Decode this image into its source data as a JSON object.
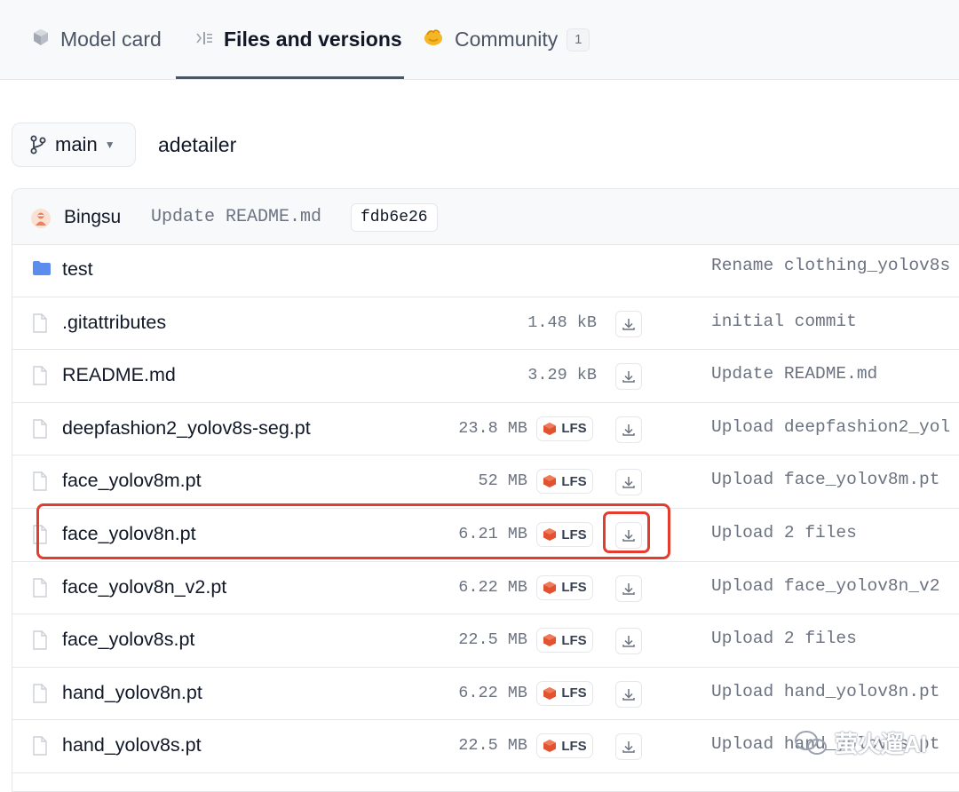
{
  "tabs": [
    {
      "label": "Model card",
      "icon": "cube-icon",
      "active": false
    },
    {
      "label": "Files and versions",
      "icon": "files-icon",
      "active": true
    },
    {
      "label": "Community",
      "icon": "hand-icon",
      "active": false,
      "count": "1"
    }
  ],
  "branch": {
    "label": "main"
  },
  "repo_name": "adetailer",
  "last_commit": {
    "author": "Bingsu",
    "message": "Update README.md",
    "sha": "fdb6e26"
  },
  "files": [
    {
      "name": "test",
      "type": "folder",
      "size": "",
      "lfs": false,
      "commit": "Rename clothing_yolov8s"
    },
    {
      "name": ".gitattributes",
      "type": "file",
      "size": "1.48 kB",
      "lfs": false,
      "commit": "initial commit"
    },
    {
      "name": "README.md",
      "type": "file",
      "size": "3.29 kB",
      "lfs": false,
      "commit": "Update README.md"
    },
    {
      "name": "deepfashion2_yolov8s-seg.pt",
      "type": "file",
      "size": "23.8 MB",
      "lfs": true,
      "commit": "Upload deepfashion2_yol"
    },
    {
      "name": "face_yolov8m.pt",
      "type": "file",
      "size": "52 MB",
      "lfs": true,
      "commit": "Upload face_yolov8m.pt"
    },
    {
      "name": "face_yolov8n.pt",
      "type": "file",
      "size": "6.21 MB",
      "lfs": true,
      "commit": "Upload 2 files",
      "highlighted": true
    },
    {
      "name": "face_yolov8n_v2.pt",
      "type": "file",
      "size": "6.22 MB",
      "lfs": true,
      "commit": "Upload face_yolov8n_v2"
    },
    {
      "name": "face_yolov8s.pt",
      "type": "file",
      "size": "22.5 MB",
      "lfs": true,
      "commit": "Upload 2 files"
    },
    {
      "name": "hand_yolov8n.pt",
      "type": "file",
      "size": "6.22 MB",
      "lfs": true,
      "commit": "Upload hand_yolov8n.pt"
    },
    {
      "name": "hand_yolov8s.pt",
      "type": "file",
      "size": "22.5 MB",
      "lfs": true,
      "commit": "Upload hand_yolov8s.pt"
    }
  ],
  "lfs_label": "LFS",
  "watermark": "萤火遛AI",
  "colors": {
    "highlight": "#e43d2f",
    "folder": "#5b8def",
    "lfs": "#e2522f"
  }
}
